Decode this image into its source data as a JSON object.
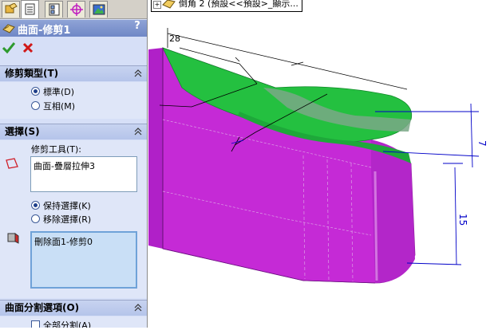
{
  "tabs": [
    {
      "name": "FeatureManager"
    },
    {
      "name": "PropertyManager"
    },
    {
      "name": "ConfigurationManager"
    },
    {
      "name": "DimXpertManager"
    },
    {
      "name": "DisplayManager"
    }
  ],
  "property_manager": {
    "title": "曲面-修剪1",
    "help": "?",
    "ok_icon": "check-icon",
    "cancel_icon": "x-icon"
  },
  "trim_type": {
    "header": "修剪類型(T)",
    "options": [
      {
        "label": "標準(D)",
        "selected": true
      },
      {
        "label": "互相(M)",
        "selected": false
      }
    ]
  },
  "selections": {
    "header": "選擇(S)",
    "tool_label": "修剪工具(T):",
    "tool_value": "曲面-疊層拉伸3",
    "options": [
      {
        "label": "保持選擇(K)",
        "selected": true
      },
      {
        "label": "移除選擇(R)",
        "selected": false
      }
    ],
    "pieces_value": "刪除面1-修剪0"
  },
  "split_options": {
    "header": "曲面分割選項(O)",
    "split_all_label": "全部分割(A)"
  },
  "tree_node": {
    "label": "倒角 2 (預設<<預設>_顯示..."
  },
  "dimensions": {
    "d1": "28",
    "d2": "7",
    "d3": "15"
  },
  "colors": {
    "accent_title": "#7a8fcd",
    "body_magenta": "#c52ad6",
    "surface_green": "#20c040",
    "dimension_blue": "#0000c8"
  }
}
